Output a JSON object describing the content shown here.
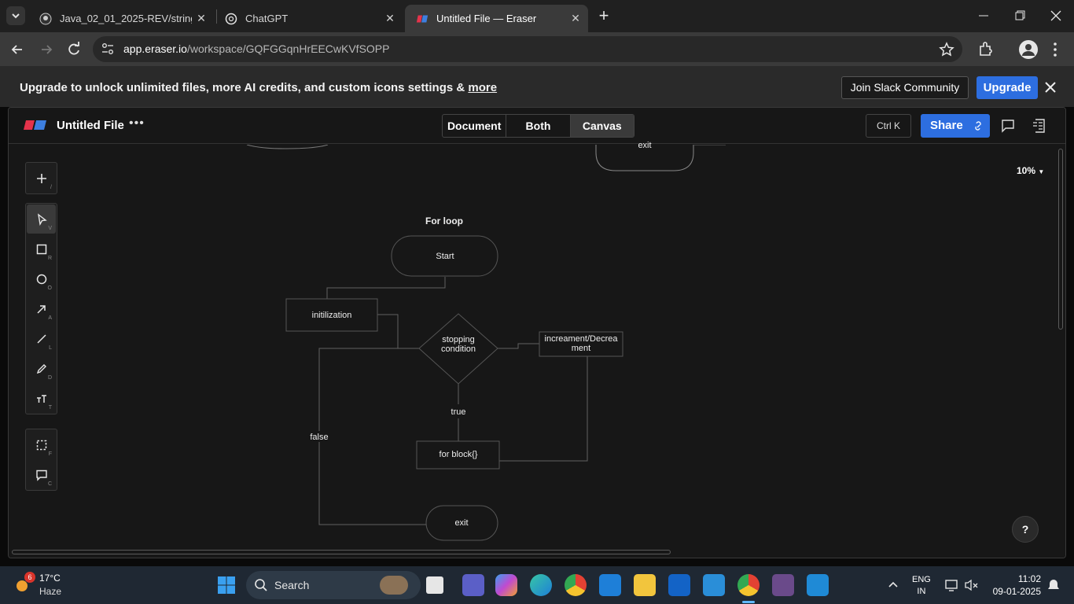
{
  "browser": {
    "tabs": [
      {
        "title": "Java_02_01_2025-REV/strings_ja",
        "icon": "github-icon",
        "active": false
      },
      {
        "title": "ChatGPT",
        "icon": "chatgpt-icon",
        "active": false
      },
      {
        "title": "Untitled File — Eraser",
        "icon": "eraser-icon",
        "active": true
      }
    ],
    "new_tab": "+",
    "url_host": "app.eraser.io",
    "url_path": "/workspace/GQFGGqnHrEECwKVfSOPP"
  },
  "banner": {
    "text": "Upgrade to unlock unlimited files, more AI credits, and custom icons settings &",
    "link": "more",
    "slack_button": "Join Slack Community",
    "upgrade_button": "Upgrade"
  },
  "app": {
    "file_title": "Untitled File",
    "more": "•••",
    "view_modes": [
      "Document",
      "Both",
      "Canvas"
    ],
    "selected_view": "Canvas",
    "shortcut": "Ctrl K",
    "share": "Share",
    "zoom": "10%",
    "help": "?"
  },
  "tools": {
    "add": {
      "icon": "plus-icon",
      "key": "/"
    },
    "main": [
      {
        "name": "select",
        "icon": "cursor-icon",
        "key": "V",
        "selected": true
      },
      {
        "name": "rectangle",
        "icon": "square-icon",
        "key": "R"
      },
      {
        "name": "ellipse",
        "icon": "circle-icon",
        "key": "O"
      },
      {
        "name": "arrow",
        "icon": "arrow-icon",
        "key": "A"
      },
      {
        "name": "line",
        "icon": "line-icon",
        "key": "L"
      },
      {
        "name": "draw",
        "icon": "pencil-icon",
        "key": "D"
      },
      {
        "name": "text",
        "icon": "text-icon",
        "key": "T"
      }
    ],
    "extra": [
      {
        "name": "frame",
        "icon": "frame-icon",
        "key": "F"
      },
      {
        "name": "comment",
        "icon": "comment-icon",
        "key": "C"
      }
    ]
  },
  "diagram": {
    "title": "For loop",
    "top_exit": "exit",
    "start": "Start",
    "init": "initilization",
    "condition_line1": "stopping",
    "condition_line2": "condition",
    "increment_line1": "increament/Decrea",
    "increment_line2": "ment",
    "true_label": "true",
    "false_label": "false",
    "block": "for block{}",
    "exit": "exit"
  },
  "taskbar": {
    "weather_badge": "6",
    "temp": "17°C",
    "weather": "Haze",
    "search": "Search",
    "lang1": "ENG",
    "lang2": "IN",
    "time": "11:02",
    "date": "09-01-2025"
  }
}
